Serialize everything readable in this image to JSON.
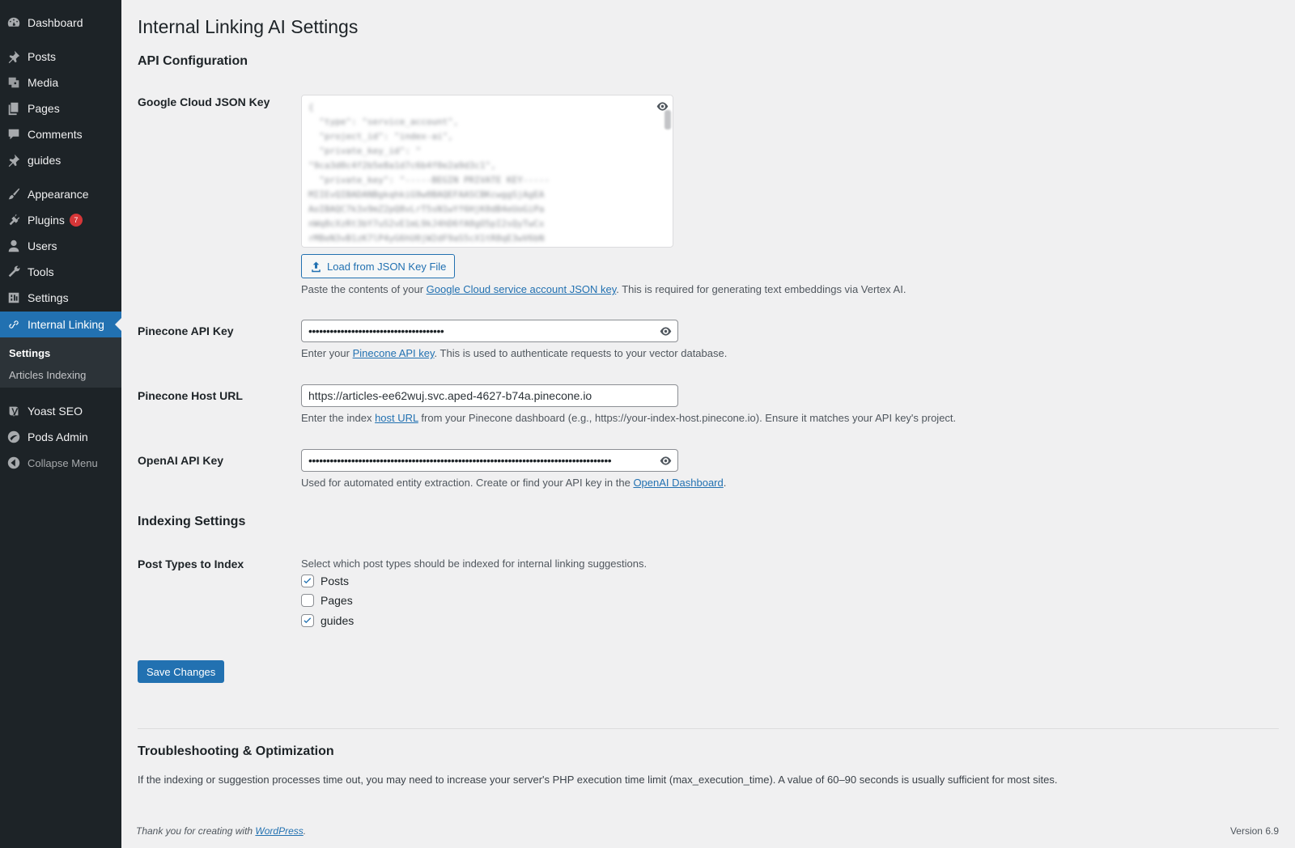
{
  "sidebar": {
    "items": [
      {
        "label": "Dashboard",
        "icon": "dashboard-icon"
      },
      {
        "label": "Posts",
        "icon": "pin-icon"
      },
      {
        "label": "Media",
        "icon": "media-icon"
      },
      {
        "label": "Pages",
        "icon": "pages-icon"
      },
      {
        "label": "Comments",
        "icon": "comment-icon"
      },
      {
        "label": "guides",
        "icon": "pin-icon"
      },
      {
        "label": "Appearance",
        "icon": "paintbrush-icon"
      },
      {
        "label": "Plugins",
        "icon": "plugin-icon",
        "badge": "7"
      },
      {
        "label": "Users",
        "icon": "user-icon"
      },
      {
        "label": "Tools",
        "icon": "wrench-icon"
      },
      {
        "label": "Settings",
        "icon": "settings-icon"
      },
      {
        "label": "Internal Linking",
        "icon": "link-icon"
      },
      {
        "label": "Yoast SEO",
        "icon": "yoast-icon"
      },
      {
        "label": "Pods Admin",
        "icon": "pods-icon"
      },
      {
        "label": "Collapse Menu",
        "icon": "collapse-icon"
      }
    ],
    "submenu": [
      "Settings",
      "Articles Indexing"
    ]
  },
  "page": {
    "title": "Internal Linking AI Settings",
    "api_section": "API Configuration",
    "json_key_label": "Google Cloud JSON Key",
    "load_button": "Load from JSON Key File",
    "json_desc_pre": "Paste the contents of your ",
    "json_desc_link": "Google Cloud service account JSON key",
    "json_desc_post": ". This is required for generating text embeddings via Vertex AI.",
    "pinecone_key_label": "Pinecone API Key",
    "pinecone_key_value": "••••••••••••••••••••••••••••••••••••••",
    "pinecone_desc_pre": "Enter your ",
    "pinecone_desc_link": "Pinecone API key",
    "pinecone_desc_post": ". This is used to authenticate requests to your vector database.",
    "host_label": "Pinecone Host URL",
    "host_value": "https://articles-ee62wuj.svc.aped-4627-b74a.pinecone.io",
    "host_desc_pre": "Enter the index ",
    "host_desc_link": "host URL",
    "host_desc_post": " from your Pinecone dashboard (e.g., https://your-index-host.pinecone.io). Ensure it matches your API key's project.",
    "openai_label": "OpenAI API Key",
    "openai_value": "•••••••••••••••••••••••••••••••••••••••••••••••••••••••••••••••••••••••••••••••••••••",
    "openai_desc_pre": "Used for automated entity extraction. Create or find your API key in the ",
    "openai_desc_link": "OpenAI Dashboard",
    "openai_desc_post": ".",
    "indexing_section": "Indexing Settings",
    "post_types_label": "Post Types to Index",
    "post_types_desc": "Select which post types should be indexed for internal linking suggestions.",
    "post_types": [
      {
        "label": "Posts",
        "checked": true
      },
      {
        "label": "Pages",
        "checked": false
      },
      {
        "label": "guides",
        "checked": true
      }
    ],
    "save_button": "Save Changes",
    "trouble_section": "Troubleshooting & Optimization",
    "trouble_text": "If the indexing or suggestion processes time out, you may need to increase your server's PHP execution time limit (max_execution_time). A value of 60–90 seconds is usually sufficient for most sites."
  },
  "footer": {
    "thanks_pre": "Thank you for creating with ",
    "thanks_link": "WordPress",
    "thanks_post": ".",
    "version": "Version 6.9"
  },
  "colors": {
    "sidebar_bg": "#1d2327",
    "accent": "#2271b1",
    "badge": "#d63638",
    "content_bg": "#f0f0f1"
  }
}
